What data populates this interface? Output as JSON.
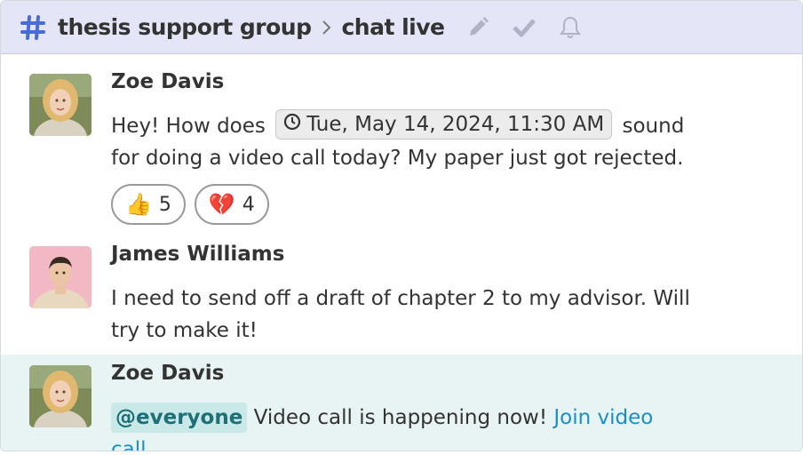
{
  "header": {
    "stream": "thesis support group",
    "topic": "chat live",
    "colors": {
      "hash": "#4a6cd9",
      "icons": "#a8aabb",
      "bar": "#e4e6f8"
    }
  },
  "messages": [
    {
      "sender": "Zoe Davis",
      "text_before": "Hey! How does",
      "time": "Tue, May 14, 2024, 11:30 AM",
      "text_after": "sound for doing a video call today? My paper just got rejected.",
      "reactions": [
        {
          "emoji": "👍",
          "count": "5"
        },
        {
          "emoji": "💔",
          "count": "4"
        }
      ]
    },
    {
      "sender": "James Williams",
      "text": "I need to send off a draft of chapter 2 to my advisor. Will try to make it!"
    },
    {
      "sender": "Zoe Davis",
      "mention": "@everyone",
      "text": "Video call is happening now!",
      "link": "Join video call."
    }
  ]
}
